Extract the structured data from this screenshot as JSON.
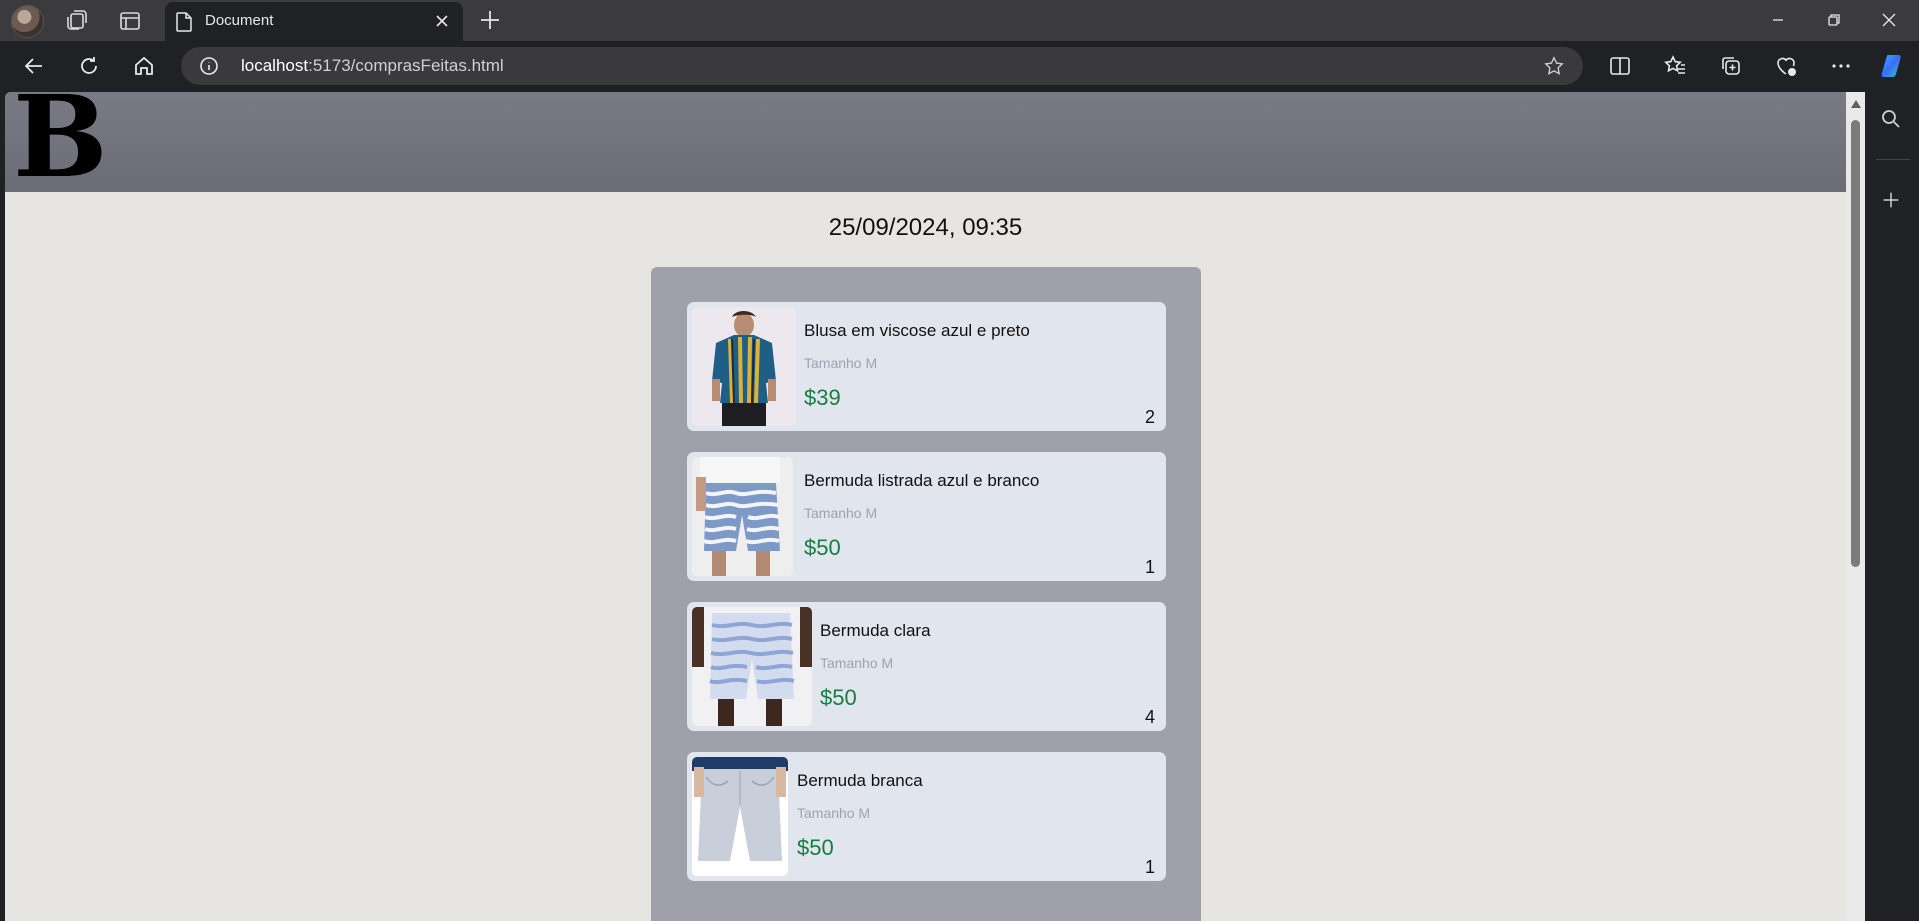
{
  "browser": {
    "tab_title": "Document",
    "url_host": "localhost",
    "url_path": ":5173/comprasFeitas.html"
  },
  "page": {
    "logo": "B",
    "purchase_date": "25/09/2024, 09:35",
    "items": [
      {
        "name": "Blusa em viscose azul e preto",
        "size": "Tamanho M",
        "price": "$39",
        "qty": "2"
      },
      {
        "name": "Bermuda listrada azul e branco",
        "size": "Tamanho M",
        "price": "$50",
        "qty": "1"
      },
      {
        "name": "Bermuda clara",
        "size": "Tamanho M",
        "price": "$50",
        "qty": "4"
      },
      {
        "name": "Bermuda branca",
        "size": "Tamanho M",
        "price": "$50",
        "qty": "1"
      }
    ]
  },
  "icons": {
    "tabs_menu": "workspaces-icon",
    "vertical_tabs": "tab-actions-icon",
    "price_color": "#157f3d",
    "header_color": "#70707a",
    "panel_color": "#a0a0aa",
    "card_color": "#e1e5ee"
  }
}
